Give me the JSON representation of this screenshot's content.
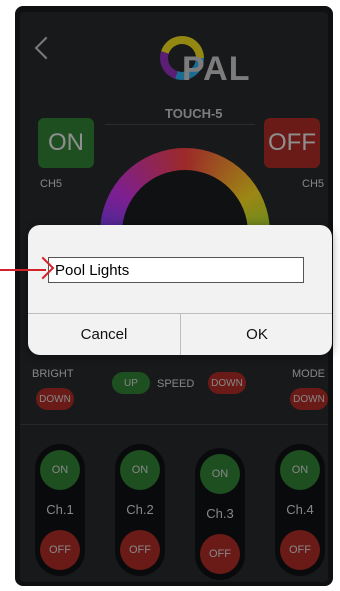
{
  "app": {
    "logo_text": "PAL",
    "model": "TOUCH-5"
  },
  "top_controls": {
    "on_label": "ON",
    "off_label": "OFF",
    "channel_label": "CH5"
  },
  "bottom_controls": {
    "bright_label": "BRIGHT",
    "down_label": "DOWN",
    "up_label": "UP",
    "speed_label": "SPEED",
    "mode_label": "MODE"
  },
  "channels": [
    {
      "name": "Ch.1",
      "on_label": "ON",
      "off_label": "OFF"
    },
    {
      "name": "Ch.2",
      "on_label": "ON",
      "off_label": "OFF"
    },
    {
      "name": "Ch.3",
      "on_label": "ON",
      "off_label": "OFF"
    },
    {
      "name": "Ch.4",
      "on_label": "ON",
      "off_label": "OFF"
    }
  ],
  "dialog": {
    "input_value": "Pool Lights",
    "cancel_label": "Cancel",
    "ok_label": "OK"
  },
  "colors": {
    "on_green": "#2f7a33",
    "off_red": "#a52a24",
    "annotation_red": "#d4222a"
  }
}
